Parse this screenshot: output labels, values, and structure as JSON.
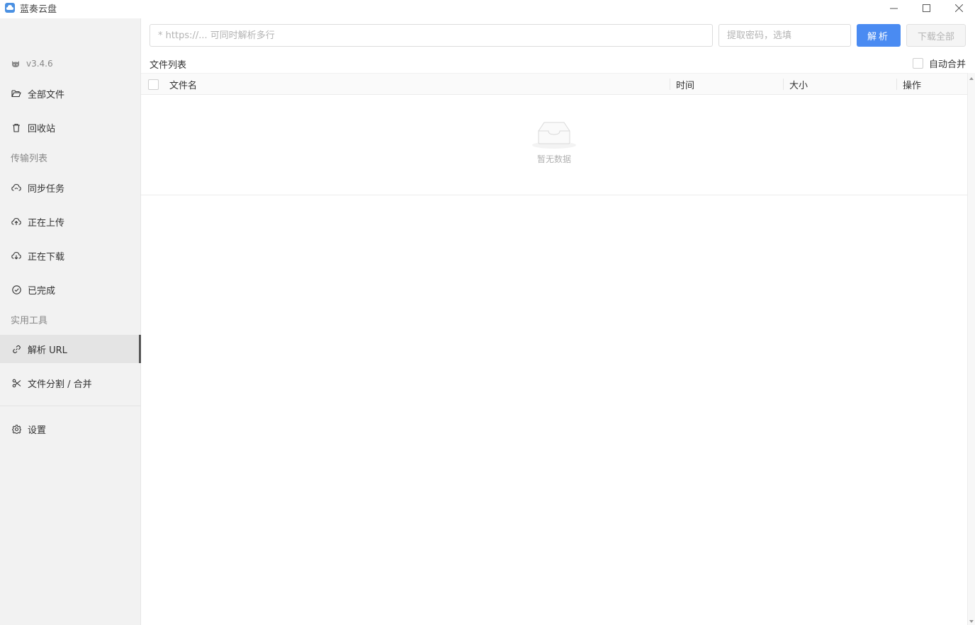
{
  "window": {
    "title": "蓝奏云盘",
    "minimize_icon": "minimize-icon",
    "maximize_icon": "maximize-icon",
    "close_icon": "close-icon"
  },
  "sidebar": {
    "version": "v3.4.6",
    "items": [
      {
        "label": "全部文件",
        "icon": "folder-open-icon"
      },
      {
        "label": "回收站",
        "icon": "trash-icon"
      },
      {
        "label": "同步任务",
        "icon": "cloud-sync-icon"
      },
      {
        "label": "正在上传",
        "icon": "cloud-upload-icon"
      },
      {
        "label": "正在下载",
        "icon": "cloud-download-icon"
      },
      {
        "label": "已完成",
        "icon": "check-circle-icon"
      },
      {
        "label": "解析 URL",
        "icon": "link-icon"
      },
      {
        "label": "文件分割 / 合并",
        "icon": "scissors-icon"
      },
      {
        "label": "设置",
        "icon": "gear-icon"
      }
    ],
    "sections": {
      "transfer": "传输列表",
      "tools": "实用工具"
    },
    "active": "解析 URL"
  },
  "toolbar": {
    "url_placeholder": "* https://... 可同时解析多行",
    "url_value": "",
    "password_placeholder": "提取密码，选填",
    "password_value": "",
    "parse_label": "解析",
    "download_all_label": "下载全部"
  },
  "file_list": {
    "title": "文件列表",
    "auto_merge_label": "自动合并",
    "auto_merge_checked": false,
    "columns": [
      "文件名",
      "时间",
      "大小",
      "操作"
    ],
    "rows": [],
    "empty_text": "暂无数据"
  },
  "colors": {
    "primary": "#4a8bf2",
    "sidebar_bg": "#f2f2f2",
    "active_item_bg": "#e4e4e4"
  }
}
